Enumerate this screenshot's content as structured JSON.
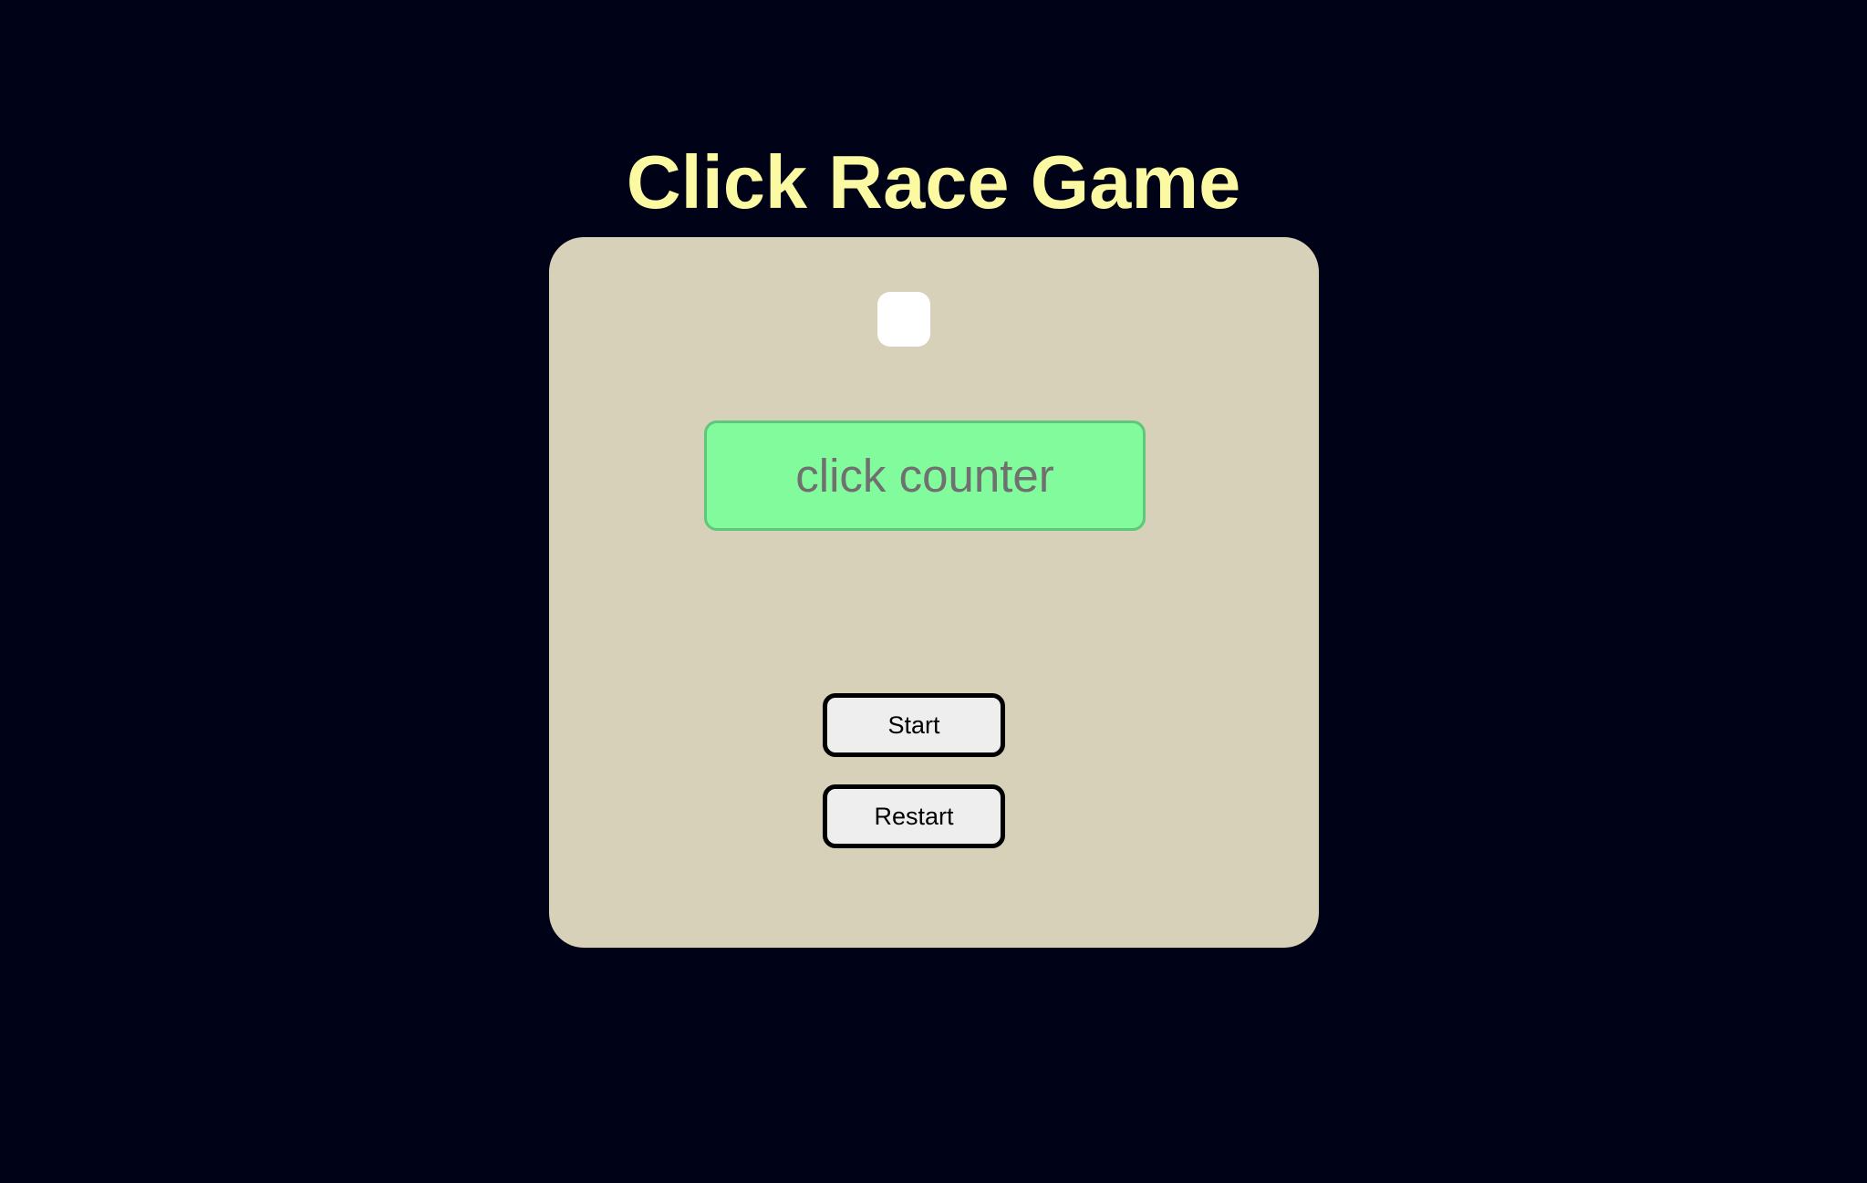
{
  "game": {
    "title": "Click Race Game",
    "timer_display": "",
    "counter": {
      "value": "",
      "placeholder": "click counter"
    },
    "buttons": {
      "start_label": "Start",
      "restart_label": "Restart"
    }
  },
  "colors": {
    "background": "#000218",
    "title": "#fbf9a1",
    "card": "#d7d1b9",
    "counter_fill": "#82fb9d",
    "counter_border": "#5ec77b",
    "button_fill": "#eeeeee"
  }
}
